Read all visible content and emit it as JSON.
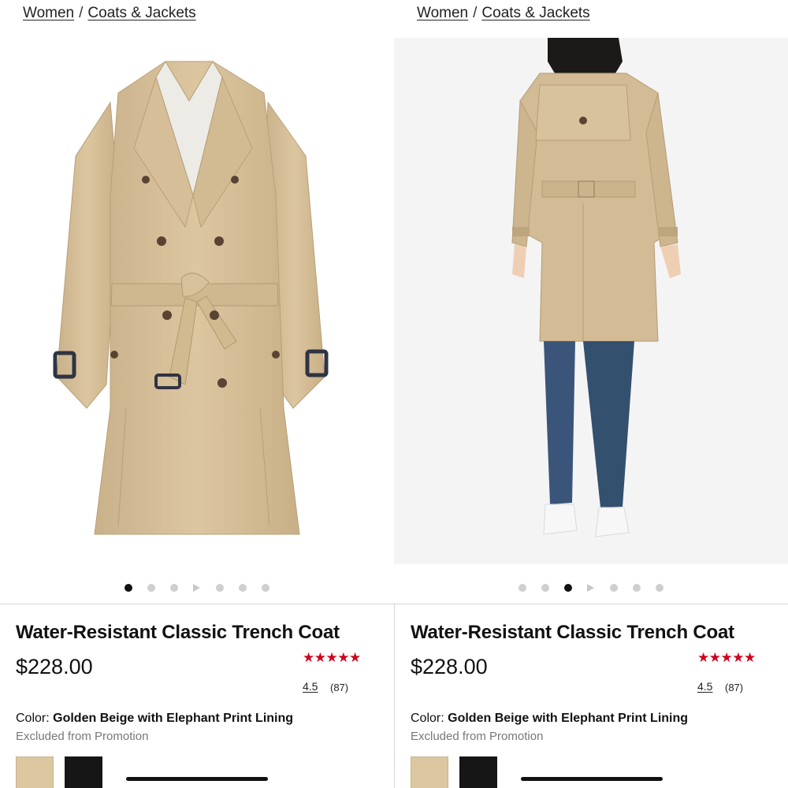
{
  "panels": [
    {
      "breadcrumb": {
        "first": "Women",
        "separator": "/",
        "second": "Coats & Jackets"
      },
      "gallery": {
        "image": "trench-coat-front",
        "active_dot": 0
      },
      "product": {
        "title": "Water-Resistant Classic Trench Coat",
        "price": "$228.00",
        "stars": "★★★★★",
        "rating": "4.5",
        "review_count": "(87)",
        "color_label": "Color:",
        "color_name": "Golden Beige with Elephant Print Lining",
        "promo": "Excluded from Promotion",
        "swatches": [
          "golden-beige",
          "black"
        ]
      }
    },
    {
      "breadcrumb": {
        "first": "Women",
        "separator": "/",
        "second": "Coats & Jackets"
      },
      "gallery": {
        "image": "trench-coat-back-model",
        "active_dot": 2
      },
      "product": {
        "title": "Water-Resistant Classic Trench Coat",
        "price": "$228.00",
        "stars": "★★★★★",
        "rating": "4.5",
        "review_count": "(87)",
        "color_label": "Color:",
        "color_name": "Golden Beige with Elephant Print Lining",
        "promo": "Excluded from Promotion",
        "swatches": [
          "golden-beige",
          "black"
        ]
      }
    }
  ],
  "colors": {
    "star": "#d0021b",
    "swatch_beige": "#dcc7a0",
    "swatch_black": "#161616"
  }
}
